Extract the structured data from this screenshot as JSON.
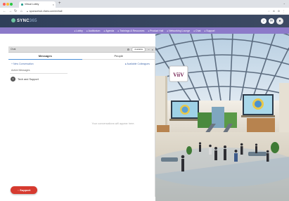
{
  "browser": {
    "tab_title": "Virtual Lobby",
    "url": "sponsorhub.vfairs.com/en/hall",
    "colors": {
      "close": "#ff5f57",
      "minimize": "#febc2e",
      "maximize": "#28c840"
    }
  },
  "header": {
    "brand": "SYNC",
    "brand_sub": "365",
    "icons": [
      "bell-icon",
      "chat-icon",
      "profile-icon"
    ]
  },
  "nav": {
    "items": [
      "Lobby",
      "Auditorium",
      "Agenda",
      "Trainings & Resources",
      "Product Hall",
      "Networking Lounge",
      "Chat",
      "Support"
    ]
  },
  "chat_panel": {
    "top_label": "Chat",
    "status_label": "Available",
    "tabs": [
      "Messages",
      "People"
    ],
    "active_tab": "Messages",
    "actions": {
      "new": "+ New Conversation",
      "online": "● Available Colleagues"
    },
    "section_label": "Active Messages",
    "conversations": [
      {
        "initial": "T",
        "label": "Tech and Support"
      }
    ],
    "empty_message": "Your conversations will appear here."
  },
  "support_button": {
    "label": "Support"
  },
  "venue": {
    "sign_text": "ViiV",
    "colors": {
      "sky": "#d7e3ee",
      "floor": "#d2c9b8",
      "carpet": "#9fb5c7",
      "accent_green": "#4a8a3e"
    }
  }
}
